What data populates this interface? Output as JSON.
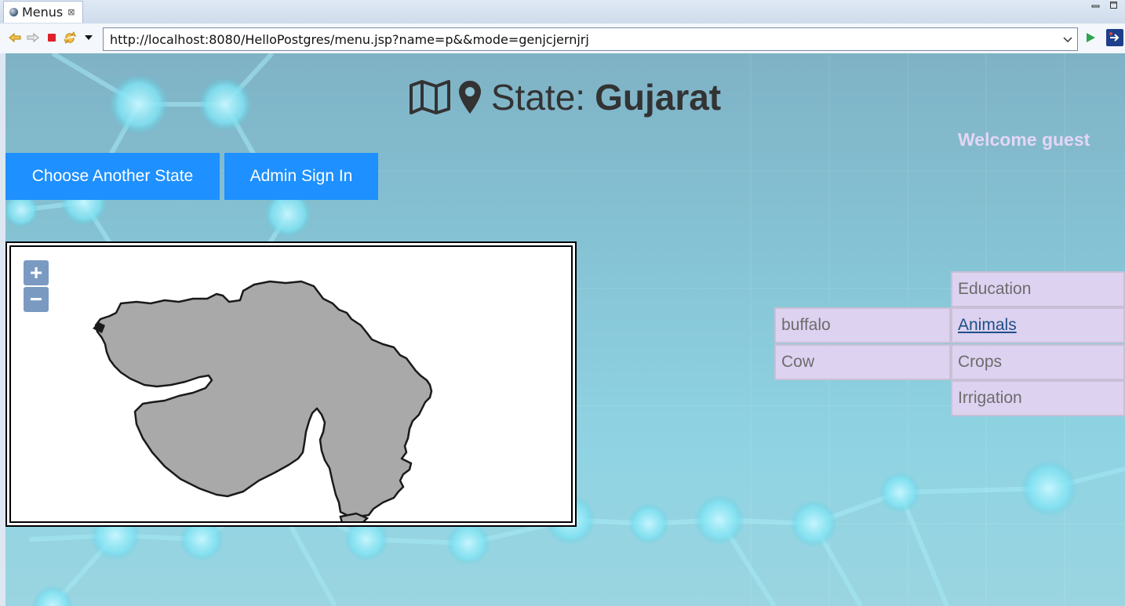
{
  "browser": {
    "tab_label": "Menus",
    "tab_close": "⊠",
    "url": "http://localhost:8080/HelloPostgres/menu.jsp?name=p&&mode=genjcjernjrj"
  },
  "page": {
    "heading_prefix": "State:",
    "state_name": "Gujarat",
    "welcome_text": "Welcome guest",
    "buttons": {
      "choose_state": "Choose Another State",
      "admin_sign_in": "Admin Sign In"
    },
    "map": {
      "zoom_in": "+",
      "zoom_out": "−"
    },
    "categories": [
      "Education",
      "Animals",
      "Crops",
      "Irrigation"
    ],
    "active_category": "Animals",
    "items": [
      "buffalo",
      "Cow"
    ]
  },
  "colors": {
    "button_blue": "#1e90ff",
    "menu_cell_bg": "#ddd2f0",
    "welcome_text": "#e4d6f5",
    "map_fill": "#a9a9a9"
  }
}
